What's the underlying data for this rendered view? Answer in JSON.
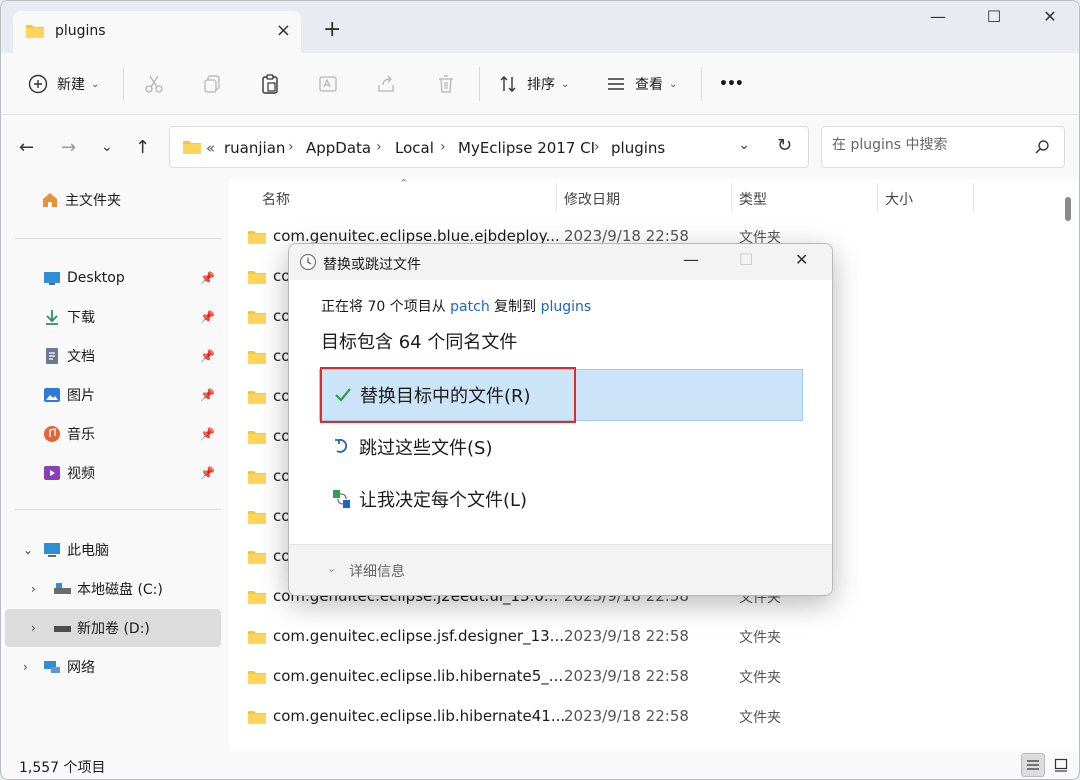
{
  "tab": {
    "title": "plugins",
    "close_icon": "×",
    "new_icon": "+"
  },
  "window_controls": {
    "minimize": "—",
    "maximize": "☐",
    "close": "✕"
  },
  "toolbar": {
    "new_label": "新建",
    "sort_label": "排序",
    "view_label": "查看",
    "more_label": "•••"
  },
  "address": {
    "overflow": "«",
    "crumbs": [
      "ruanjian",
      "AppData",
      "Local",
      "MyEclipse 2017 CI",
      "plugins"
    ],
    "separator": "›"
  },
  "search": {
    "placeholder": "在 plugins 中搜索"
  },
  "sidebar": {
    "home": "主文件夹",
    "quick": [
      {
        "label": "Desktop",
        "color": "#2f8fd6"
      },
      {
        "label": "下载",
        "color": "#2a8f5c"
      },
      {
        "label": "文档",
        "color": "#6b7a90"
      },
      {
        "label": "图片",
        "color": "#2f7ad6"
      },
      {
        "label": "音乐",
        "color": "#e0663a"
      },
      {
        "label": "视频",
        "color": "#8a3fb5"
      }
    ],
    "this_pc": "此电脑",
    "drives": [
      "本地磁盘 (C:)",
      "新加卷 (D:)"
    ],
    "network": "网络"
  },
  "columns": {
    "name": "名称",
    "date": "修改日期",
    "type": "类型",
    "size": "大小"
  },
  "rows": [
    {
      "name": "com.genuitec.eclipse.blue.ejbdeploy...",
      "date": "2023/9/18 22:58",
      "type": "文件夹"
    },
    {
      "name": "co",
      "date": "",
      "type": ""
    },
    {
      "name": "co",
      "date": "",
      "type": ""
    },
    {
      "name": "co",
      "date": "",
      "type": ""
    },
    {
      "name": "co",
      "date": "",
      "type": ""
    },
    {
      "name": "co",
      "date": "",
      "type": ""
    },
    {
      "name": "co",
      "date": "",
      "type": ""
    },
    {
      "name": "co",
      "date": "",
      "type": ""
    },
    {
      "name": "co",
      "date": "",
      "type": ""
    },
    {
      "name": "com.genuitec.eclipse.j2eedt.ui_13.0...",
      "date": "2023/9/18 22:58",
      "type": "文件夹"
    },
    {
      "name": "com.genuitec.eclipse.jsf.designer_13...",
      "date": "2023/9/18 22:58",
      "type": "文件夹"
    },
    {
      "name": "com.genuitec.eclipse.lib.hibernate5_...",
      "date": "2023/9/18 22:58",
      "type": "文件夹"
    },
    {
      "name": "com.genuitec.eclipse.lib.hibernate41...",
      "date": "2023/9/18 22:58",
      "type": "文件夹"
    }
  ],
  "status": {
    "count": "1,557 个项目"
  },
  "dialog": {
    "title": "替换或跳过文件",
    "line1_prefix": "正在将 70 个项目从 ",
    "line1_source": "patch",
    "line1_mid": " 复制到 ",
    "line1_target": "plugins",
    "line2_prefix": "目标包含 ",
    "line2_count": "64",
    "line2_suffix": " 个同名文件",
    "options": [
      "替换目标中的文件(R)",
      "跳过这些文件(S)",
      "让我决定每个文件(L)"
    ],
    "details": "详细信息"
  },
  "colors": {
    "accent": "#1a66c2",
    "highlight": "#cce4f7",
    "folder": "#f4c443",
    "annotation_red": "#e02b2b"
  }
}
